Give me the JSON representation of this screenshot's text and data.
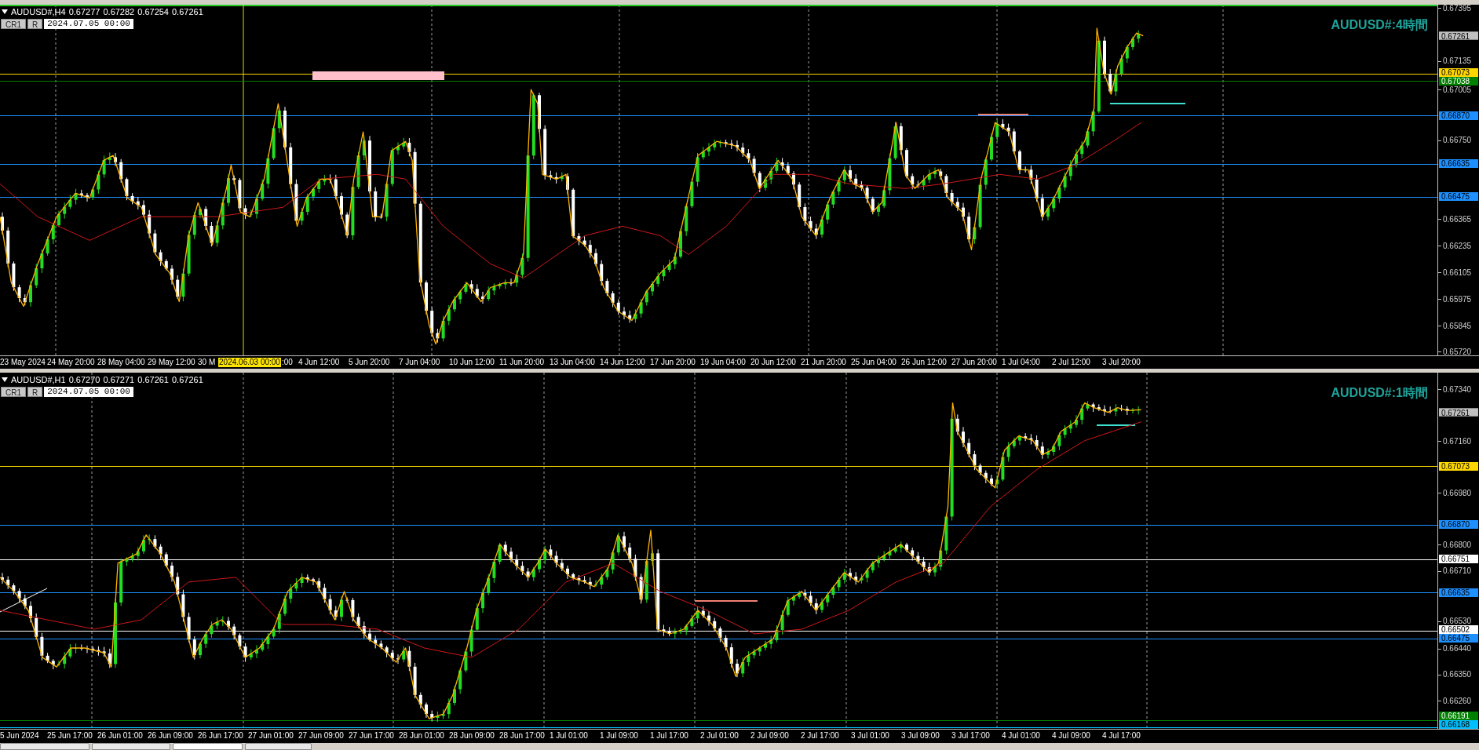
{
  "top_pane": {
    "header": {
      "symbol": "AUDUSD#,H4",
      "values": [
        "0.67277",
        "0.67282",
        "0.67254",
        "0.67261"
      ]
    },
    "buttons": [
      "CR1",
      "R"
    ],
    "date_field": "2024.07.05 00:00",
    "title": "AUDUSD#:4時間",
    "axis_ticks": [
      "0.67395",
      "0.67135",
      "0.67005",
      "0.66750",
      "0.66365",
      "0.66235",
      "0.66105",
      "0.65975",
      "0.65845",
      "0.65720"
    ],
    "price_labels": [
      {
        "text": "0.67261",
        "kind": "current",
        "color": "#c0c0c0"
      },
      {
        "text": "0.67073",
        "kind": "level",
        "color": "#ffd700"
      },
      {
        "text": "0.67038",
        "kind": "level",
        "color": "#008000"
      },
      {
        "text": "0.66870",
        "kind": "level",
        "color": "#1e90ff"
      },
      {
        "text": "0.66635",
        "kind": "level",
        "color": "#1e90ff"
      },
      {
        "text": "0.66475",
        "kind": "level",
        "color": "#1e90ff"
      }
    ],
    "time_labels": [
      {
        "text": "23 May 2024",
        "kind": "normal"
      },
      {
        "text": "24 May 20:00",
        "kind": "normal"
      },
      {
        "text": "28 May 04:00",
        "kind": "normal"
      },
      {
        "text": "29 May 12:00",
        "kind": "normal"
      },
      {
        "text": "30 M",
        "kind": "normal"
      },
      {
        "text": "2024.06.03 00:00",
        "kind": "highlight"
      },
      {
        "text": ":00",
        "kind": "tail"
      },
      {
        "text": "4 Jun 12:00",
        "kind": "normal"
      },
      {
        "text": "5 Jun 20:00",
        "kind": "normal"
      },
      {
        "text": "7 Jun 04:00",
        "kind": "normal"
      },
      {
        "text": "10 Jun 12:00",
        "kind": "normal"
      },
      {
        "text": "11 Jun 20:00",
        "kind": "normal"
      },
      {
        "text": "13 Jun 04:00",
        "kind": "normal"
      },
      {
        "text": "14 Jun 12:00",
        "kind": "normal"
      },
      {
        "text": "17 Jun 20:00",
        "kind": "normal"
      },
      {
        "text": "19 Jun 04:00",
        "kind": "normal"
      },
      {
        "text": "20 Jun 12:00",
        "kind": "normal"
      },
      {
        "text": "21 Jun 20:00",
        "kind": "normal"
      },
      {
        "text": "25 Jun 04:00",
        "kind": "normal"
      },
      {
        "text": "26 Jun 12:00",
        "kind": "normal"
      },
      {
        "text": "27 Jun 20:00",
        "kind": "normal"
      },
      {
        "text": "1 Jul 04:00",
        "kind": "normal"
      },
      {
        "text": "2 Jul 12:00",
        "kind": "normal"
      },
      {
        "text": "3 Jul 20:00",
        "kind": "normal"
      }
    ]
  },
  "bottom_pane": {
    "header": {
      "symbol": "AUDUSD#,H1",
      "values": [
        "0.67270",
        "0.67271",
        "0.67261",
        "0.67261"
      ]
    },
    "buttons": [
      "CR1",
      "R"
    ],
    "date_field": "2024.07.05 00:00",
    "title": "AUDUSD#:1時間",
    "axis_ticks": [
      "0.67340",
      "0.67160",
      "0.66980",
      "0.66800",
      "0.66710",
      "0.66530",
      "0.66440",
      "0.66350",
      "0.66260"
    ],
    "price_labels": [
      {
        "text": "0.67261",
        "kind": "current",
        "color": "#c0c0c0"
      },
      {
        "text": "0.67073",
        "kind": "level",
        "color": "#ffd700"
      },
      {
        "text": "0.66870",
        "kind": "level",
        "color": "#1e90ff"
      },
      {
        "text": "0.66751",
        "kind": "level",
        "color": "#ffffff"
      },
      {
        "text": "0.66635",
        "kind": "level",
        "color": "#1e90ff"
      },
      {
        "text": "0.66502",
        "kind": "level",
        "color": "#ffffff"
      },
      {
        "text": "0.66475",
        "kind": "level",
        "color": "#1e90ff"
      },
      {
        "text": "0.66191",
        "kind": "level",
        "color": "#008000"
      },
      {
        "text": "0.66168",
        "kind": "level",
        "color": "#00bfff"
      }
    ],
    "time_labels": [
      {
        "text": "5 Jun 2024",
        "kind": "normal"
      },
      {
        "text": "25 Jun 17:00",
        "kind": "normal"
      },
      {
        "text": "26 Jun 01:00",
        "kind": "normal"
      },
      {
        "text": "26 Jun 09:00",
        "kind": "normal"
      },
      {
        "text": "26 Jun 17:00",
        "kind": "normal"
      },
      {
        "text": "27 Jun 01:00",
        "kind": "normal"
      },
      {
        "text": "27 Jun 09:00",
        "kind": "normal"
      },
      {
        "text": "27 Jun 17:00",
        "kind": "normal"
      },
      {
        "text": "28 Jun 01:00",
        "kind": "normal"
      },
      {
        "text": "28 Jun 09:00",
        "kind": "normal"
      },
      {
        "text": "28 Jun 17:00",
        "kind": "normal"
      },
      {
        "text": "1 Jul 01:00",
        "kind": "normal"
      },
      {
        "text": "1 Jul 09:00",
        "kind": "normal"
      },
      {
        "text": "1 Jul 17:00",
        "kind": "normal"
      },
      {
        "text": "2 Jul 01:00",
        "kind": "normal"
      },
      {
        "text": "2 Jul 09:00",
        "kind": "normal"
      },
      {
        "text": "2 Jul 17:00",
        "kind": "normal"
      },
      {
        "text": "3 Jul 01:00",
        "kind": "normal"
      },
      {
        "text": "3 Jul 09:00",
        "kind": "normal"
      },
      {
        "text": "3 Jul 17:00",
        "kind": "normal"
      },
      {
        "text": "4 Jul 01:00",
        "kind": "normal"
      },
      {
        "text": "4 Jul 09:00",
        "kind": "normal"
      },
      {
        "text": "4 Jul 17:00",
        "kind": "normal"
      }
    ]
  },
  "tabs": [
    {
      "selected": false
    },
    {
      "selected": false
    },
    {
      "selected": true
    },
    {
      "selected": false
    }
  ]
}
